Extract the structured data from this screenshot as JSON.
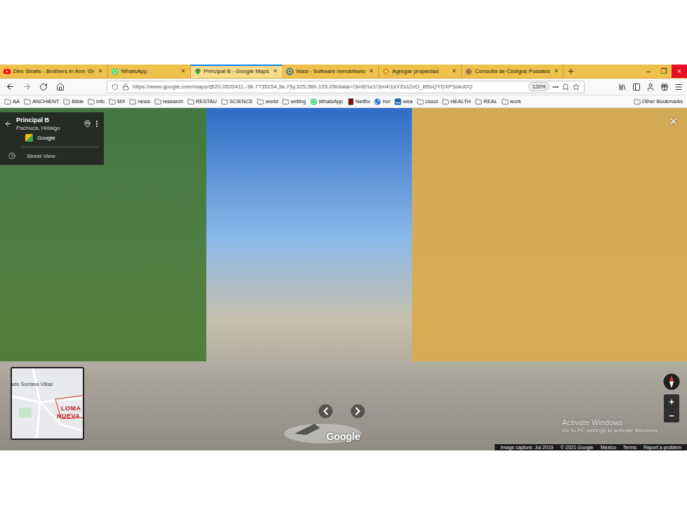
{
  "browser": {
    "tabs": [
      {
        "label": "Dire Straits - Brothers In Arm",
        "selected": false,
        "kind": "youtube",
        "audio": true,
        "close": "×"
      },
      {
        "label": "WhatsApp",
        "selected": false,
        "kind": "whatsapp",
        "audio": false,
        "close": "×"
      },
      {
        "label": "Principal B - Google Maps",
        "selected": true,
        "kind": "maps",
        "audio": false,
        "close": "×"
      },
      {
        "label": "Wasi - Software inmobiliario",
        "selected": false,
        "kind": "wasi",
        "audio": false,
        "close": "×"
      },
      {
        "label": "Agregar propiedad",
        "selected": false,
        "kind": "gear",
        "audio": false,
        "close": "×"
      },
      {
        "label": "Consulta de Códigos Postales",
        "selected": false,
        "kind": "dot",
        "audio": false,
        "close": "×"
      }
    ],
    "window_controls": [
      "–",
      "❐",
      "×"
    ],
    "url": "https://www.google.com/maps/@20.0520411,-98.7735154,3a,75y,325.36h,103.05t/data=!3m6!1e1!3m4!1sYZs12zO_B5oQYDXPSskd2Q",
    "zoom": "120%",
    "page_actions": "•••",
    "bookmarks": [
      {
        "label": "AA",
        "kind": "folder"
      },
      {
        "label": "ANCHIENT",
        "kind": "folder"
      },
      {
        "label": "Bible",
        "kind": "folder"
      },
      {
        "label": "info",
        "kind": "folder"
      },
      {
        "label": "MX",
        "kind": "folder"
      },
      {
        "label": "news",
        "kind": "folder"
      },
      {
        "label": "research",
        "kind": "folder"
      },
      {
        "label": "RESTAU",
        "kind": "folder"
      },
      {
        "label": "SCIENCE",
        "kind": "folder"
      },
      {
        "label": "world",
        "kind": "folder"
      },
      {
        "label": "writing",
        "kind": "folder"
      },
      {
        "label": "WhatsApp",
        "kind": "whatsapp"
      },
      {
        "label": "Netflix",
        "kind": "netflix"
      },
      {
        "label": "hur",
        "kind": "site"
      },
      {
        "label": "wea",
        "kind": "app"
      },
      {
        "label": "cloud",
        "kind": "folder"
      },
      {
        "label": "HEALTH",
        "kind": "folder"
      },
      {
        "label": "REAL",
        "kind": "folder"
      },
      {
        "label": "work",
        "kind": "folder"
      }
    ],
    "other_bookmarks": "Other Bookmarks"
  },
  "street_view": {
    "place": {
      "title": "Principal B",
      "subtitle": "Pachuca, Hidalgo",
      "source": "Google",
      "mode": "Street View"
    },
    "close": "×",
    "minimap": {
      "labels": [
        "ado Soriana Villas",
        "LOMA",
        "NUEVA"
      ]
    },
    "zoom_in": "+",
    "zoom_out": "−",
    "watermark": "Google",
    "activation": {
      "title": "Activate Windows",
      "subtitle": "Go to PC settings to activate Windows."
    },
    "footer": [
      "Image capture: Jul 2019",
      "© 2021 Google",
      "Mexico",
      "Terms",
      "Report a problem"
    ]
  }
}
